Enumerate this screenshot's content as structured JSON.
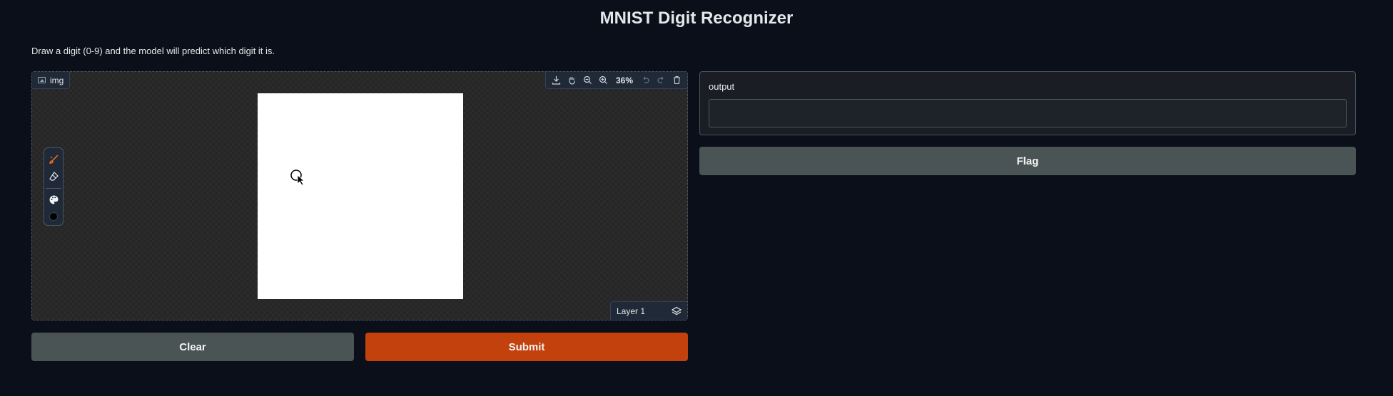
{
  "app": {
    "title": "MNIST Digit Recognizer",
    "description": "Draw a digit (0-9) and the model will predict which digit it is."
  },
  "editor": {
    "label": "img",
    "zoom": "36%",
    "layer": "Layer 1",
    "toolbar_icons": [
      "download-icon",
      "pan-icon",
      "zoom-out-icon",
      "zoom-in-icon",
      "undo-icon",
      "redo-icon",
      "trash-icon"
    ],
    "brush_color": "#000000",
    "canvas_color": "#ffffff"
  },
  "buttons": {
    "clear": "Clear",
    "submit": "Submit",
    "flag": "Flag"
  },
  "output": {
    "label": "output",
    "value": ""
  },
  "colors": {
    "background": "#0b0f19",
    "primary": "#c2410c",
    "secondary": "#4b5454"
  }
}
